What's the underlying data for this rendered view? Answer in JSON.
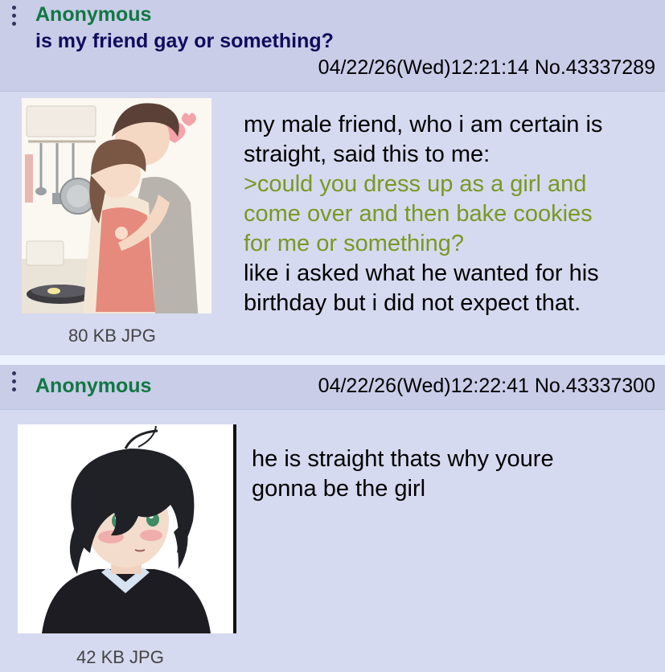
{
  "posts": [
    {
      "name": "Anonymous",
      "subject": "is my friend gay or something?",
      "date": "04/22/26(Wed)12:21:14",
      "number": "No.43337289",
      "file_info": "80 KB JPG",
      "image_icon": "anime-couple-cooking-thumbnail",
      "lines": [
        {
          "text": "my male friend, who i am certain is",
          "type": "normal"
        },
        {
          "text": "straight, said this to me:",
          "type": "normal"
        },
        {
          "text": ">could you dress up as a girl and",
          "type": "quote"
        },
        {
          "text": "come over and then bake cookies",
          "type": "quote"
        },
        {
          "text": "for me or something?",
          "type": "quote"
        },
        {
          "text": "like i asked what he wanted for his",
          "type": "normal"
        },
        {
          "text": "birthday but i did not expect that.",
          "type": "normal"
        }
      ]
    },
    {
      "name": "Anonymous",
      "date": "04/22/26(Wed)12:22:41",
      "number": "No.43337300",
      "file_info": "42 KB JPG",
      "image_icon": "anime-boy-blushing-thumbnail",
      "lines": [
        {
          "text": "he is straight thats why youre",
          "type": "normal"
        },
        {
          "text": "gonna be the girl",
          "type": "normal"
        }
      ]
    }
  ],
  "colors": {
    "name": "#117743",
    "subject": "#0f0c5d",
    "quote": "#789922",
    "post_bg": "#d6daf0",
    "header_bg": "#c9cde8"
  }
}
